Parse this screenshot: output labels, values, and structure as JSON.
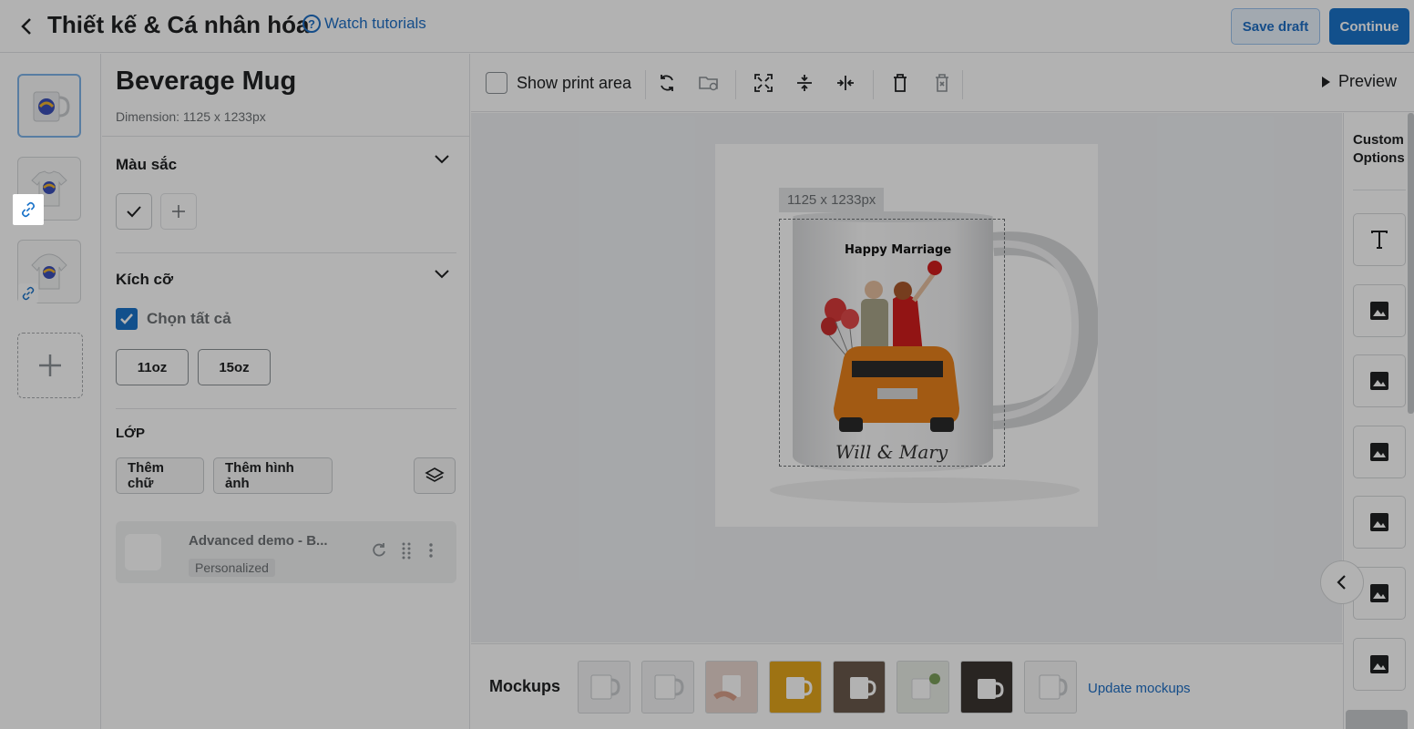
{
  "header": {
    "back_icon": "chevron-left-icon",
    "title": "Thiết kế & Cá nhân hóa",
    "tutorial_label": "Watch tutorials",
    "save_draft": "Save draft",
    "continue": "Continue"
  },
  "thumbnails": {
    "add_icon": "plus-icon",
    "items": [
      {
        "label": "mug",
        "active": true
      },
      {
        "label": "t-shirt",
        "linked": true
      },
      {
        "label": "hoodie",
        "linked": true
      }
    ]
  },
  "panel": {
    "product_name": "Beverage Mug",
    "dimension": "Dimension: 1125 x 1233px",
    "color_section": "Màu sắc",
    "size_section": "Kích cỡ",
    "select_all": "Chọn tất cả",
    "sizes": [
      "11oz",
      "15oz"
    ],
    "layer_section": "LỚP",
    "add_text": "Thêm chữ",
    "add_image": "Thêm hình ảnh",
    "layer_item": {
      "name": "Advanced demo - B...",
      "badge": "Personalized"
    }
  },
  "toolbar": {
    "show_print_area": "Show print area",
    "preview": "Preview"
  },
  "canvas": {
    "print_size": "1125 x 1233px",
    "mug_title": "Happy Marriage",
    "mug_names": "Will & Mary"
  },
  "right_bar": {
    "title_line1": "Custom",
    "title_line2": "Options"
  },
  "mockups": {
    "label": "Mockups",
    "update": "Update mockups"
  },
  "colors": {
    "primary": "#1a73c9",
    "link": "#1f6fc5"
  }
}
